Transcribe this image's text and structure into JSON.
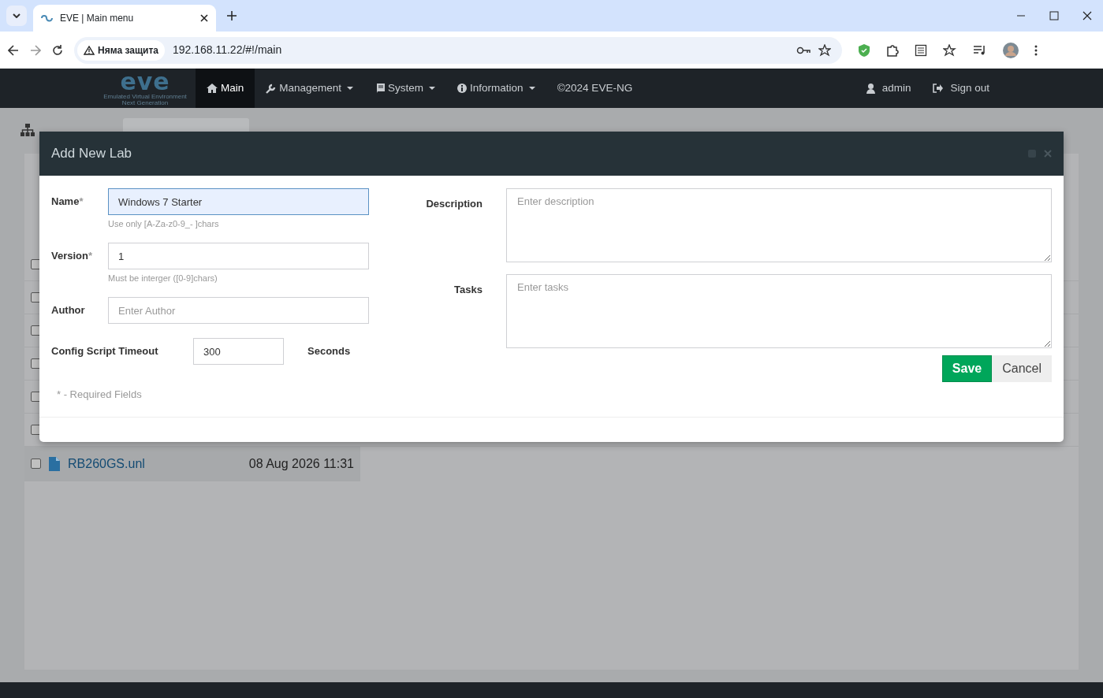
{
  "browser": {
    "tab_title": "EVE | Main menu",
    "security_chip": "Няма защита",
    "url": "192.168.11.22/#!/main"
  },
  "navbar": {
    "logo": "eve",
    "logo_tagline": "Emulated Virtual Environment",
    "logo_subtagline": "Next Generation",
    "items": [
      {
        "label": "Main",
        "kind": "home",
        "dropdown": false,
        "selected": true
      },
      {
        "label": "Management",
        "kind": "wrench",
        "dropdown": true,
        "selected": false
      },
      {
        "label": "System",
        "kind": "book",
        "dropdown": true,
        "selected": false
      },
      {
        "label": "Information",
        "kind": "info",
        "dropdown": true,
        "selected": false
      },
      {
        "label": "©2024 EVE-NG",
        "kind": "text",
        "dropdown": false,
        "selected": false
      }
    ],
    "user": "admin",
    "sign_out": "Sign out"
  },
  "page": {
    "files": [
      {
        "checked": false
      },
      {
        "checked": false
      },
      {
        "checked": false
      },
      {
        "checked": false
      },
      {
        "checked": false
      },
      {
        "checked": false
      },
      {
        "checked": false,
        "name": "RB260GS.unl",
        "date": "08 Aug 2026 11:31"
      }
    ]
  },
  "modal": {
    "title": "Add New Lab",
    "fields": [
      {
        "label": "Name",
        "required_mark": "*",
        "value": "Windows 7 Starter",
        "focused": true,
        "help": "Use only [A-Za-z0-9_- ]chars"
      },
      {
        "label": "Version",
        "required_mark": "*",
        "value": "1",
        "focused": false,
        "help": "Must be interger ([0-9]chars)"
      },
      {
        "label": "Author",
        "placeholder": "Enter Author",
        "focused": false
      }
    ],
    "timeout": {
      "label": "Config Script Timeout",
      "value": "300",
      "unit": "Seconds"
    },
    "required_note": "* - Required Fields",
    "textareas": [
      {
        "label": "Description",
        "placeholder": "Enter description"
      },
      {
        "label": "Tasks",
        "placeholder": "Enter tasks"
      }
    ],
    "buttons": [
      {
        "label": "Save",
        "kind": "primary"
      },
      {
        "label": "Cancel",
        "kind": "secondary"
      }
    ]
  }
}
